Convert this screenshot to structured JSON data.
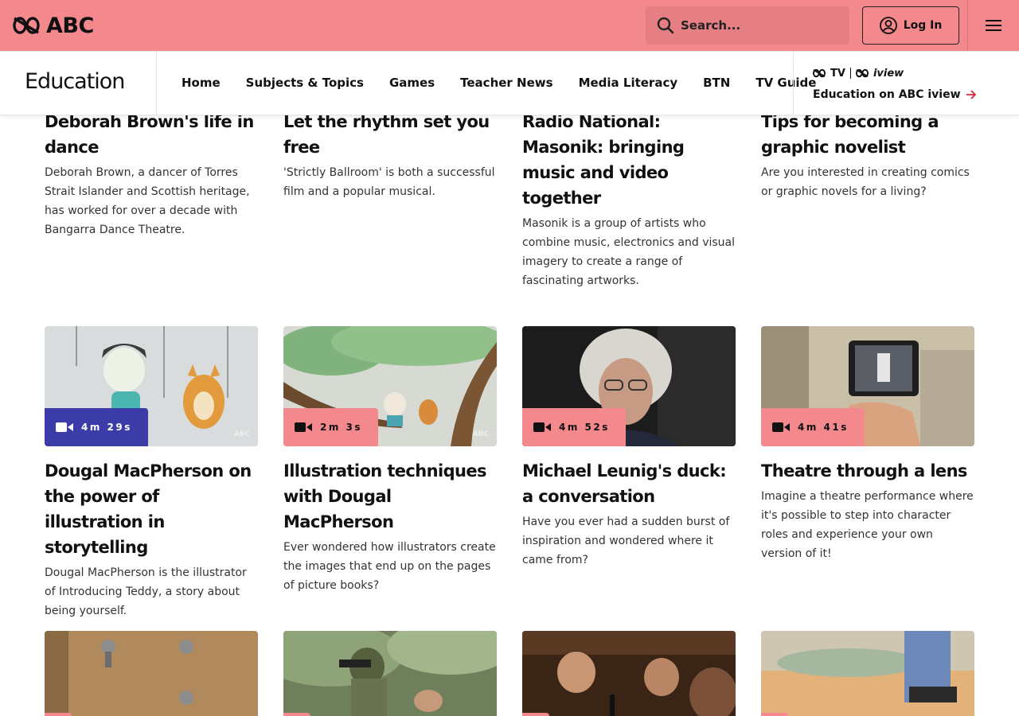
{
  "header": {
    "logo_text": "ABC",
    "search_placeholder": "Search...",
    "login_label": "Log In",
    "brand_color": "#f3888d"
  },
  "nav": {
    "section_title": "Education",
    "links": [
      "Home",
      "Subjects & Topics",
      "Games",
      "Teacher News",
      "Media Literacy",
      "BTN",
      "TV Guide"
    ],
    "iview_logo_1": "TV",
    "iview_logo_2": "iview",
    "iview_link": "Education on ABC iview"
  },
  "cards_row1": [
    {
      "title": "Deborah Brown's life in dance",
      "desc": "Deborah Brown, a dancer of Torres Strait Islander and Scottish heritage, has worked for over a decade with Bangarra Dance Theatre."
    },
    {
      "title": "Let the rhythm set you free",
      "desc": "'Strictly Ballroom' is both a successful film and a popular musical."
    },
    {
      "title": "Radio National: Masonik: bringing music and video together",
      "desc": "Masonik is a group of artists who combine music, electronics and visual imagery to create a range of fascinating artworks."
    },
    {
      "title": "Tips for becoming a graphic novelist",
      "desc": "Are you interested in creating comics or graphic novels for a living?"
    }
  ],
  "cards_row2": [
    {
      "duration": "4m 29s",
      "title": "Dougal MacPherson on the power of illustration in storytelling",
      "desc": "Dougal MacPherson is the illustrator of Introducing Teddy, a story about being yourself."
    },
    {
      "duration": "2m 3s",
      "title": "Illustration techniques with Dougal MacPherson",
      "desc": "Ever wondered how illustrators create the images that end up on the pages of picture books?"
    },
    {
      "duration": "4m 52s",
      "title": "Michael Leunig's duck: a conversation",
      "desc": "Have you ever had a sudden burst of inspiration and wondered where it came from?"
    },
    {
      "duration": "4m 41s",
      "title": "Theatre through a lens",
      "desc": "Imagine a theatre performance where it's possible to step into character roles and experience your own version of it!"
    }
  ],
  "icons": {
    "search": "search-icon",
    "user": "user-icon",
    "menu": "menu-icon",
    "video": "video-icon",
    "arrow": "arrow-right-icon"
  }
}
